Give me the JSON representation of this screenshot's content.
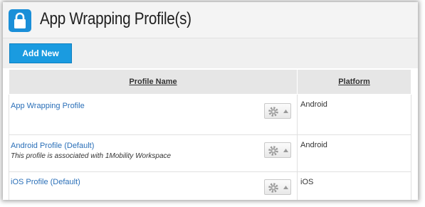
{
  "header": {
    "title": "App Wrapping Profile(s)",
    "icon": "lock-icon",
    "icon_color": "#1a8fd8"
  },
  "toolbar": {
    "add_new_label": "Add New",
    "accent": "#1a9be0"
  },
  "table": {
    "columns": [
      "Profile Name",
      "Platform"
    ],
    "rows": [
      {
        "name": "App Wrapping Profile",
        "note": "",
        "platform": "Android"
      },
      {
        "name": "Android Profile (Default)",
        "note": "This profile is associated with 1Mobility Workspace",
        "platform": "Android"
      },
      {
        "name": "iOS Profile (Default)",
        "note": "",
        "platform": "iOS"
      }
    ],
    "row_action_icon": "gear-icon"
  }
}
